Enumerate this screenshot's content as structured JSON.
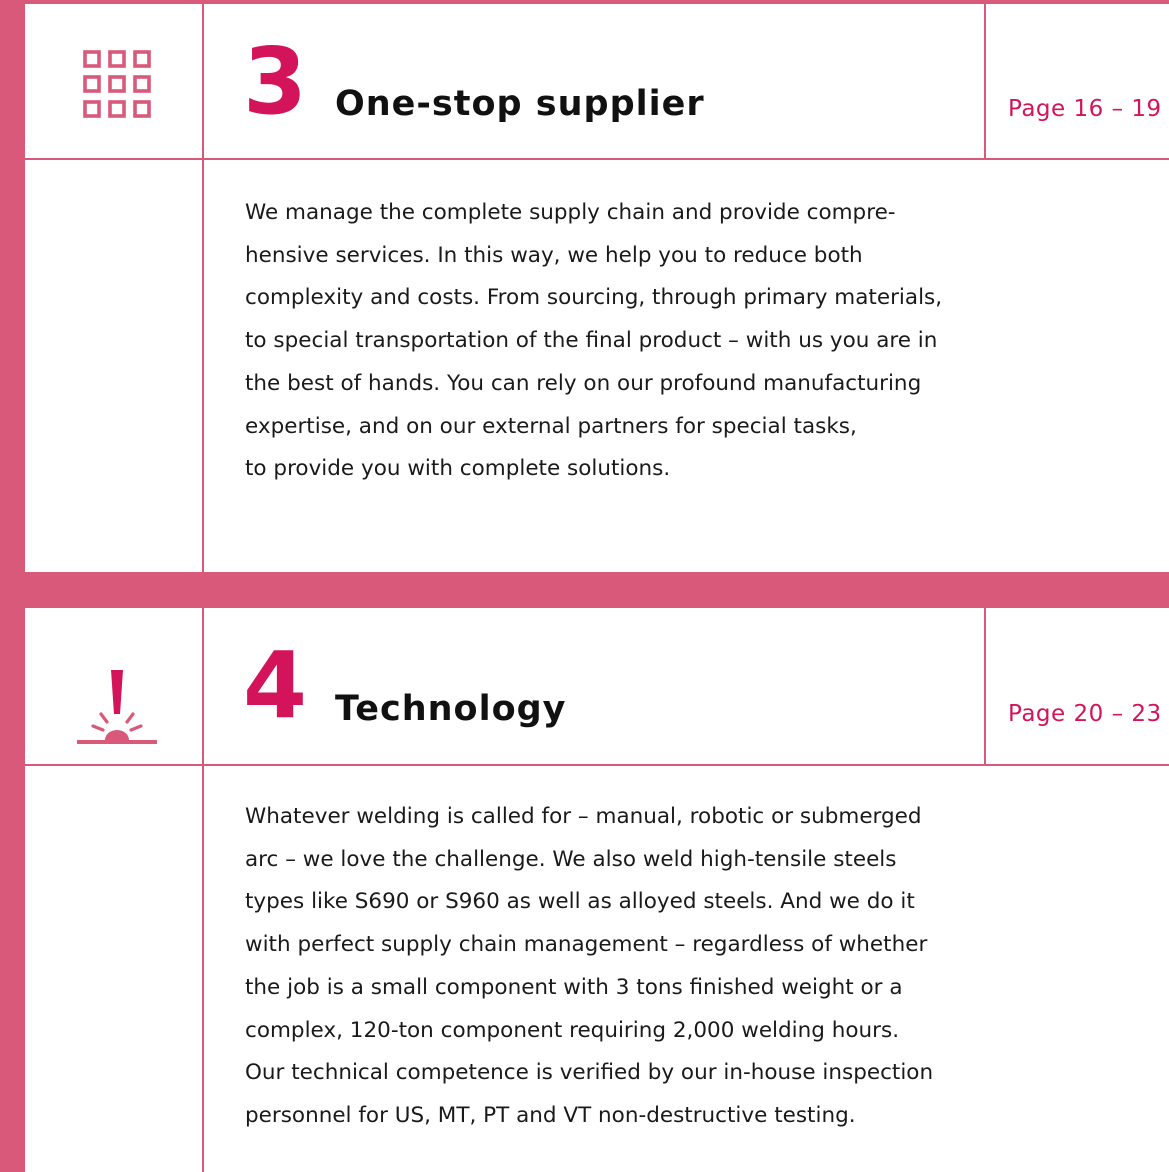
{
  "colors": {
    "accent": "#d9597a",
    "number": "#d4145a",
    "page_ref": "#d4145a",
    "text": "#1a1a1a"
  },
  "sections": [
    {
      "icon": "grid-icon",
      "number": "3",
      "title": "One-stop supplier",
      "page_ref": "Page 16 – 19",
      "body": "We manage the complete supply chain and provide compre-\nhensive services. In this way, we help you to reduce both\ncomplexity and costs. From sourcing, through primary materials,\nto special transportation of the final product – with us you are in\nthe best of hands. You can rely on our profound manufacturing\nexpertise, and on our external partners for special tasks,\nto provide you with complete solutions."
    },
    {
      "icon": "welding-icon",
      "number": "4",
      "title": "Technology",
      "page_ref": "Page 20 – 23",
      "body": "Whatever welding is called for – manual, robotic or submerged\narc – we love the challenge. We also weld high-tensile steels\ntypes like S690 or S960 as well as alloyed steels. And we do it\nwith perfect supply chain management – regardless of whether\nthe job is a small component with 3 tons finished weight or a\ncomplex, 120-ton component requiring 2,000 welding hours.\nOur technical competence is verified by our in-house inspection\npersonnel for US, MT, PT and VT non-destructive testing."
    }
  ]
}
